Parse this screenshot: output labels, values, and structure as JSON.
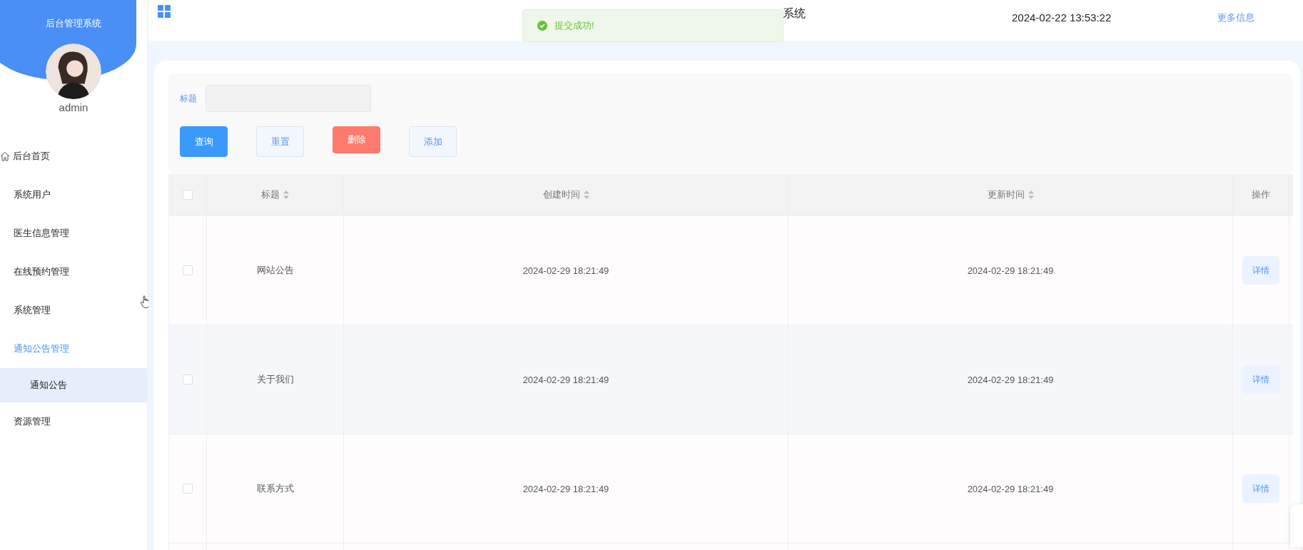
{
  "sidebar": {
    "title": "后台管理系统",
    "username": "admin",
    "items": [
      {
        "label": "后台首页",
        "kind": "home",
        "selected": false,
        "expanded": false
      },
      {
        "label": "系统用户",
        "kind": "menu",
        "selected": false,
        "expanded": false
      },
      {
        "label": "医生信息管理",
        "kind": "menu",
        "selected": false,
        "expanded": false
      },
      {
        "label": "在线预约管理",
        "kind": "menu",
        "selected": false,
        "expanded": false
      },
      {
        "label": "系统管理",
        "kind": "menu",
        "selected": false,
        "expanded": false
      },
      {
        "label": "通知公告管理",
        "kind": "menu",
        "selected": false,
        "expanded": true,
        "children": [
          {
            "label": "通知公告",
            "selected": true
          }
        ]
      },
      {
        "label": "资源管理",
        "kind": "menu",
        "selected": false,
        "expanded": false
      }
    ]
  },
  "header": {
    "title": "系统",
    "datetime": "2024-02-22 13:53:22",
    "more_link": "更多信息"
  },
  "toast": {
    "kind": "success",
    "message": "提交成功!"
  },
  "search": {
    "label": "标题",
    "buttons": [
      {
        "label": "查询",
        "kind": "primary"
      },
      {
        "label": "重置",
        "kind": "plain"
      },
      {
        "label": "删除",
        "kind": "danger"
      },
      {
        "label": "添加",
        "kind": "plain"
      }
    ]
  },
  "table": {
    "all_checked": false,
    "columns": [
      {
        "label": "标题",
        "sortable": true
      },
      {
        "label": "创建时间",
        "sortable": true
      },
      {
        "label": "更新时间",
        "sortable": true
      },
      {
        "label": "操作",
        "sortable": false
      }
    ],
    "rows": [
      {
        "checked": false,
        "title": "网站公告",
        "created": "2024-02-29 18:21:49",
        "updated": "2024-02-29 18:21:49",
        "action": "详情"
      },
      {
        "checked": false,
        "title": "关于我们",
        "created": "2024-02-29 18:21:49",
        "updated": "2024-02-29 18:21:49",
        "action": "详情"
      },
      {
        "checked": false,
        "title": "联系方式",
        "created": "2024-02-29 18:21:49",
        "updated": "2024-02-29 18:21:49",
        "action": "详情"
      }
    ]
  }
}
